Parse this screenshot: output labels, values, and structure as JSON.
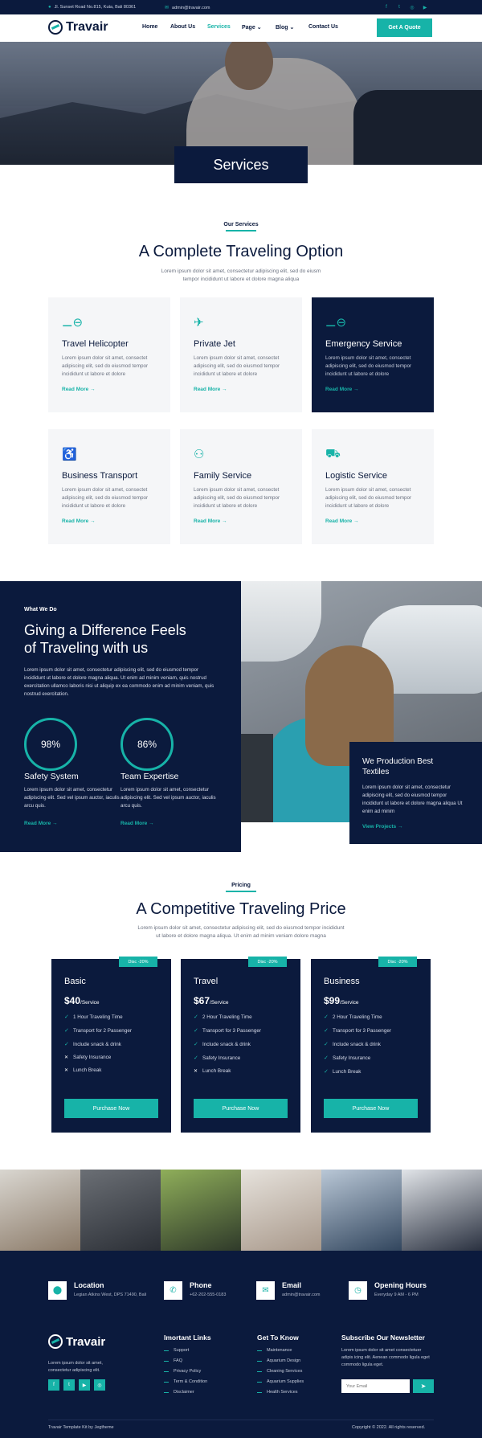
{
  "topbar": {
    "address": "Jl. Sunset Road No.815, Kuta, Bali 80361",
    "email": "admin@travair.com",
    "social_icons": [
      "facebook-icon",
      "twitter-icon",
      "instagram-icon",
      "youtube-icon"
    ]
  },
  "nav": {
    "brand": "Travair",
    "items": [
      {
        "label": "Home",
        "active": false
      },
      {
        "label": "About Us",
        "active": false
      },
      {
        "label": "Services",
        "active": true
      },
      {
        "label": "Page",
        "active": false,
        "dropdown": true
      },
      {
        "label": "Blog",
        "active": false,
        "dropdown": true
      },
      {
        "label": "Contact Us",
        "active": false
      }
    ],
    "cta": "Get A Quote"
  },
  "hero": {
    "title": "Services"
  },
  "services": {
    "eyebrow": "Our Services",
    "title": "A Complete Traveling Option",
    "lead_1": "Lorem ipsum dolor sit amet, consectetur adipiscing elit, sed do eiusm",
    "lead_2": "tempor incididunt ut labore et dolore magna aliqua",
    "cards": [
      {
        "title": "Travel Helicopter",
        "icon": "helicopter-icon",
        "text": "Lorem ipsum dolor sit amet, consectet adipiscing elit, sed do eiusmod tempor incididunt ut labore et dolore",
        "more": "Read More",
        "dark": false
      },
      {
        "title": "Private Jet",
        "icon": "airplane-icon",
        "text": "Lorem ipsum dolor sit amet, consectet adipiscing elit, sed do eiusmod tempor incididunt ut labore et dolore",
        "more": "Read More",
        "dark": false
      },
      {
        "title": "Emergency Service",
        "icon": "helicopter-icon",
        "text": "Lorem ipsum dolor sit amet, consectet adipiscing elit, sed do eiusmod tempor incididunt ut labore et dolore",
        "more": "Read More",
        "dark": true
      },
      {
        "title": "Business Transport",
        "icon": "seat-icon",
        "text": "Lorem ipsum dolor sit amet, consectet adipiscing elit, sed do eiusmod tempor incididunt ut labore et dolore",
        "more": "Read More",
        "dark": false
      },
      {
        "title": "Family Service",
        "icon": "family-icon",
        "text": "Lorem ipsum dolor sit amet, consectet adipiscing elit, sed do eiusmod tempor incididunt ut labore et dolore",
        "more": "Read More",
        "dark": false
      },
      {
        "title": "Logistic Service",
        "icon": "cargo-plane-icon",
        "text": "Lorem ipsum dolor sit amet, consectet adipiscing elit, sed do eiusmod tempor incididunt ut labore et dolore",
        "more": "Read More",
        "dark": false
      }
    ]
  },
  "wwd": {
    "eyebrow": "What We Do",
    "title_1": "Giving a Difference Feels",
    "title_2": "of Traveling with us",
    "text": "Lorem ipsum dolor sit amet, consectetur adipiscing elit, sed do eiusmod tempor incididunt ut labore et dolore magna aliqua. Ut enim ad minim veniam, quis nostrud exercitation ullamco laboris nisi ut aliquip ex ea commodo enim ad minim veniam, quis nostrud exercitation.",
    "stats": [
      {
        "value": "98%",
        "title": "Safety System",
        "text": "Lorem ipsum dolor sit amet, consectetur adipiscing elit. Sed vel ipsum auctor, iaculis arcu quis.",
        "more": "Read More →"
      },
      {
        "value": "86%",
        "title": "Team Expertise",
        "text": "Lorem ipsum dolor sit amet, consectetur adipiscing elit. Sed vel ipsum auctor, iaculis arcu quis.",
        "more": "Read More →"
      }
    ],
    "box": {
      "title": "We Production Best Textiles",
      "text": "Lorem ipsum dolor sit amet, consectetur adipiscing elit, sed do eiusmod tempor incididunt ut labore et dolore magna aliqua Ut enim ad minim",
      "more": "View Projects"
    }
  },
  "pricing": {
    "eyebrow": "Pricing",
    "title": "A Competitive Traveling Price",
    "lead_1": "Lorem ipsum dolor sit amet, consectetur adipiscing elit, sed do eiusmod tempor incididunt",
    "lead_2": "ut labore et dolore magna aliqua. Ut enim ad minim veniam dolore magna",
    "plans": [
      {
        "disc": "Disc -20%",
        "name": "Basic",
        "price": "$40",
        "unit": "/Service",
        "button": "Purchase Now",
        "features": [
          {
            "text": "1 Hour Traveling Time",
            "ok": true
          },
          {
            "text": "Transport for 2 Passenger",
            "ok": true
          },
          {
            "text": "Include snack & drink",
            "ok": true
          },
          {
            "text": "Safety Insurance",
            "ok": false
          },
          {
            "text": "Lunch Break",
            "ok": false
          }
        ]
      },
      {
        "disc": "Disc -20%",
        "name": "Travel",
        "price": "$67",
        "unit": "/Service",
        "button": "Purchase Now",
        "features": [
          {
            "text": "2 Hour Traveling Time",
            "ok": true
          },
          {
            "text": "Transport for 3 Passenger",
            "ok": true
          },
          {
            "text": "Include snack & drink",
            "ok": true
          },
          {
            "text": "Safety Insurance",
            "ok": true
          },
          {
            "text": "Lunch Break",
            "ok": false
          }
        ]
      },
      {
        "disc": "Disc -20%",
        "name": "Business",
        "price": "$99",
        "unit": "/Service",
        "button": "Purchase Now",
        "features": [
          {
            "text": "2 Hour Traveling Time",
            "ok": true
          },
          {
            "text": "Transport for 3 Passenger",
            "ok": true
          },
          {
            "text": "Include snack & drink",
            "ok": true
          },
          {
            "text": "Safety Insurance",
            "ok": true
          },
          {
            "text": "Lunch Break",
            "ok": true
          }
        ]
      }
    ]
  },
  "footer": {
    "contacts": [
      {
        "title": "Location",
        "value": "Legian Atkins West, DPS 71490, Bali",
        "icon": "location-icon"
      },
      {
        "title": "Phone",
        "value": "+62-202-555-0183",
        "icon": "phone-icon"
      },
      {
        "title": "Email",
        "value": "admin@travair.com",
        "icon": "mail-icon"
      },
      {
        "title": "Opening Hours",
        "value": "Everyday 9 AM - 6 PM",
        "icon": "clock-icon"
      }
    ],
    "brand": "Travair",
    "about": "Lorem ipsum dolor sit amet, consectetur adipiscing elit.",
    "important_links_title": "Imortant Links",
    "important_links": [
      "Support",
      "FAQ",
      "Privacy Policy",
      "Term & Condition",
      "Disclaimer"
    ],
    "know_title": "Get To Know",
    "know_links": [
      "Maintenance",
      "Aquarium Design",
      "Cleaning Services",
      "Aquarium Supplies",
      "Health Services"
    ],
    "newsletter_title": "Subscribe Our Newsletter",
    "newsletter_text": "Lorem ipsum dolor sit amet consectetuer adipis icing elit. Aenean commodo ligula eget commodo ligula eget.",
    "email_placeholder": "Your Email",
    "credit": "Travair Template Kit by Jegtheme",
    "copyright": "Copyright © 2022. All rights reserved."
  },
  "colors": {
    "navy": "#0b1a3d",
    "teal": "#17b3a8"
  }
}
